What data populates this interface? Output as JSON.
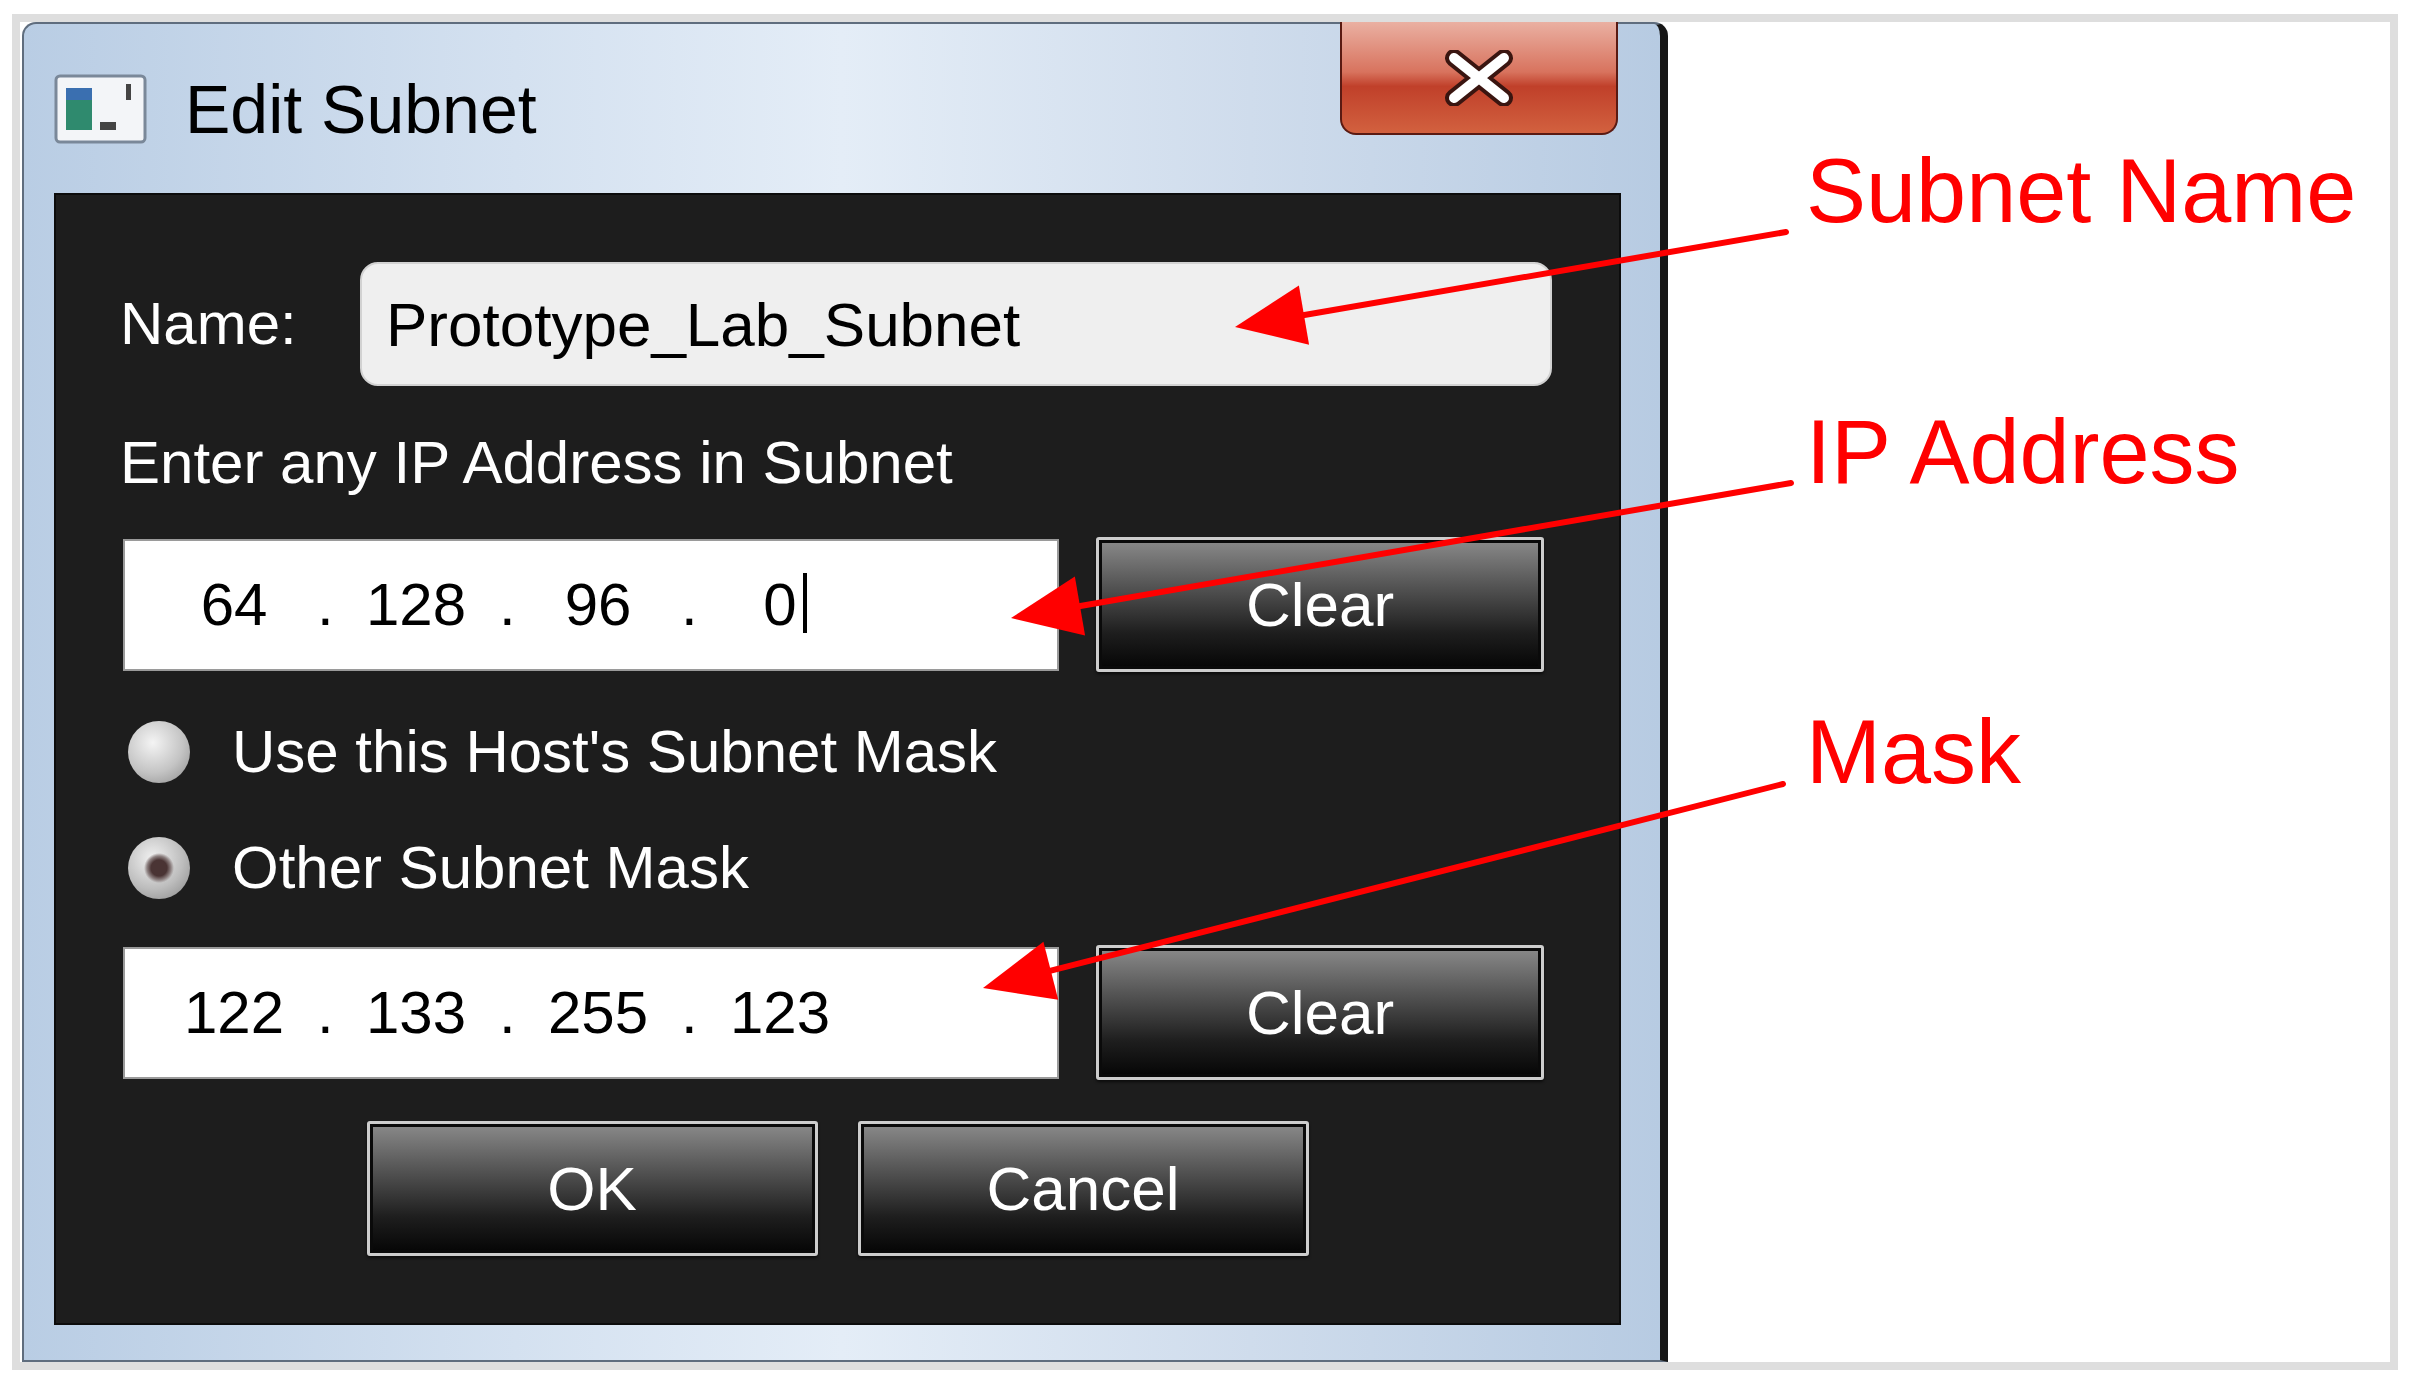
{
  "window": {
    "title": "Edit Subnet"
  },
  "name_field": {
    "label": "Name:",
    "value": "Prototype_Lab_Subnet"
  },
  "ip_section": {
    "label": "Enter any IP Address in Subnet",
    "field": {
      "octets": [
        "64",
        "128",
        "96",
        "0"
      ],
      "separators": [
        ".",
        ".",
        "."
      ],
      "focused": true
    },
    "clear_button": "Clear"
  },
  "mask_options": [
    {
      "label": "Use this Host's Subnet Mask",
      "selected": false
    },
    {
      "label": "Other Subnet Mask",
      "selected": true
    }
  ],
  "mask_section": {
    "field": {
      "octets": [
        "122",
        "133",
        "255",
        "123"
      ],
      "separators": [
        ".",
        ".",
        "."
      ],
      "focused": false
    },
    "clear_button": "Clear"
  },
  "buttons": [
    "OK",
    "Cancel"
  ],
  "annotations": [
    {
      "label": "Subnet Name"
    },
    {
      "label": "IP Address"
    },
    {
      "label": "Mask"
    }
  ]
}
